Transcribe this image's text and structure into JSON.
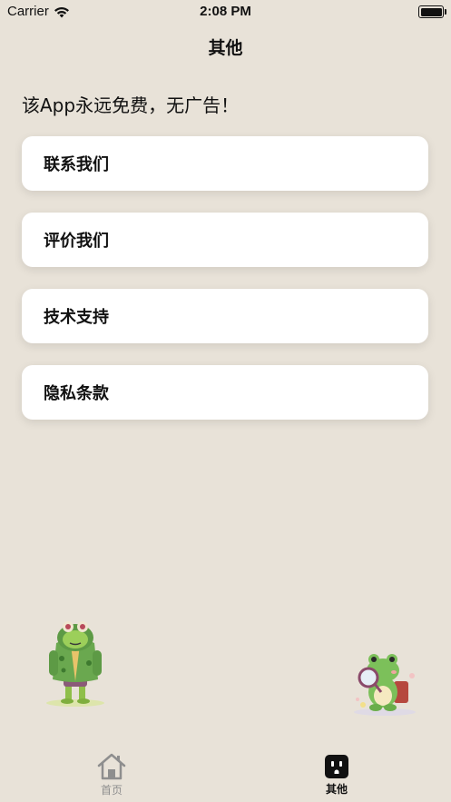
{
  "status_bar": {
    "carrier": "Carrier",
    "time": "2:08 PM",
    "wifi_icon": "wifi-icon",
    "battery_icon": "battery-full-icon"
  },
  "nav": {
    "title": "其他"
  },
  "notice": "该App永远免费，无广告！",
  "menu": [
    {
      "label": "联系我们"
    },
    {
      "label": "评价我们"
    },
    {
      "label": "技术支持"
    },
    {
      "label": "隐私条款"
    }
  ],
  "illustrations": [
    {
      "name": "frog-in-green-jacket"
    },
    {
      "name": "frog-with-magnifier"
    }
  ],
  "tabs": [
    {
      "label": "首页",
      "icon": "house-icon",
      "selected": false
    },
    {
      "label": "其他",
      "icon": "outlet-icon",
      "selected": true
    }
  ],
  "colors": {
    "background": "#e8e2d8",
    "card": "#ffffff",
    "tab_inactive": "#8e8e8e",
    "tab_active": "#111111"
  }
}
